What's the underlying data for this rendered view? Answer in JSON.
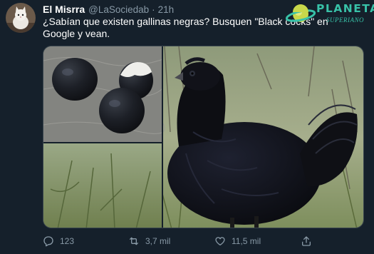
{
  "tweet": {
    "author_name": "El Misrra",
    "handle": "@LaSociedab",
    "separator": "·",
    "time": "21h",
    "text": "¿Sabían que existen gallinas negras? Busquen \"Black cocks\" en Google y vean."
  },
  "media": {
    "images": [
      {
        "icon": "black-eggs-photo"
      },
      {
        "icon": "black-hen-photo"
      }
    ]
  },
  "actions": {
    "reply_count": "123",
    "retweet_count": "3,7 mil",
    "like_count": "11,5 mil"
  },
  "watermark": {
    "title": "PLANETA",
    "subtitle": "SUPERIANO"
  },
  "colors": {
    "background": "#15202b",
    "secondary_text": "#8899a6",
    "watermark": "#38c2a8"
  }
}
